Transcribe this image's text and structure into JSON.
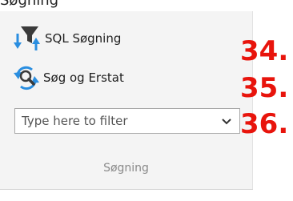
{
  "ribbon": {
    "title": "Søgning",
    "group_label": "Søgning",
    "commands": [
      {
        "label": "SQL Søgning",
        "icon": "funnel-arrows-icon"
      },
      {
        "label": "Søg og Erstat",
        "icon": "search-replace-icon"
      }
    ],
    "filter": {
      "placeholder": "Type here to filter",
      "value": ""
    }
  },
  "annotations": {
    "n34": "34.",
    "n35": "35.",
    "n36": "36."
  },
  "colors": {
    "annotation": "#e8140c",
    "panel_bg": "#f4f4f4",
    "icon_blue": "#2a8ee0",
    "icon_dark": "#3a3a3a"
  }
}
